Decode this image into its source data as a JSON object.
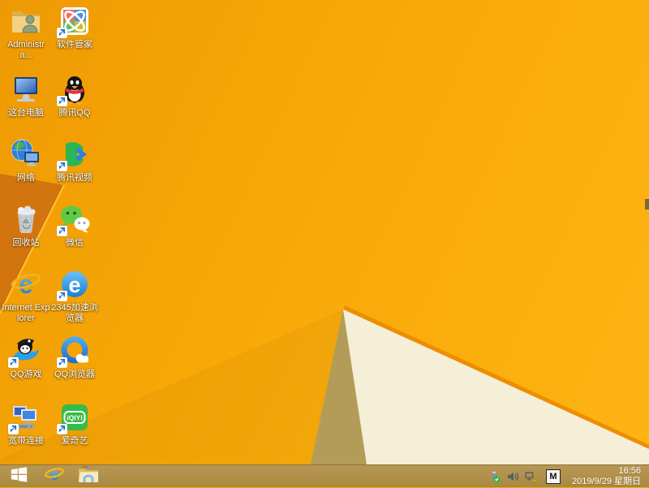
{
  "wallpaper": {
    "base_color": "#f7a807",
    "facet_cream": "#f5efd8",
    "facet_shadow_tan": "#b39c58",
    "facet_rust": "#d2750e",
    "ridge_amber": "#ee8d00",
    "ridge_light": "#ffc33a"
  },
  "desktop": {
    "icons": [
      {
        "id": "user-folder",
        "label": "Administra...",
        "col": 1,
        "row": 1,
        "shortcut": false
      },
      {
        "id": "software-manager",
        "label": "软件管家",
        "col": 2,
        "row": 1,
        "shortcut": true
      },
      {
        "id": "this-pc",
        "label": "这台电脑",
        "col": 1,
        "row": 2,
        "shortcut": false
      },
      {
        "id": "tencent-qq",
        "label": "腾讯QQ",
        "col": 2,
        "row": 2,
        "shortcut": true
      },
      {
        "id": "network",
        "label": "网络",
        "col": 1,
        "row": 3,
        "shortcut": false
      },
      {
        "id": "tencent-video",
        "label": "腾讯视频",
        "col": 2,
        "row": 3,
        "shortcut": true
      },
      {
        "id": "recycle-bin",
        "label": "回收站",
        "col": 1,
        "row": 4,
        "shortcut": false
      },
      {
        "id": "wechat",
        "label": "微信",
        "col": 2,
        "row": 4,
        "shortcut": true
      },
      {
        "id": "internet-explorer",
        "label": "Internet Explorer",
        "col": 1,
        "row": 5,
        "shortcut": false
      },
      {
        "id": "browser-2345",
        "label": "2345加速浏览器",
        "col": 2,
        "row": 5,
        "shortcut": true
      },
      {
        "id": "qq-game",
        "label": "QQ游戏",
        "col": 1,
        "row": 6,
        "shortcut": true
      },
      {
        "id": "qq-browser",
        "label": "QQ浏览器",
        "col": 2,
        "row": 6,
        "shortcut": true
      },
      {
        "id": "broadband",
        "label": "宽带连接",
        "col": 1,
        "row": 7,
        "shortcut": true
      },
      {
        "id": "iqiyi",
        "label": "爱奇艺",
        "col": 2,
        "row": 7,
        "shortcut": true
      }
    ]
  },
  "taskbar": {
    "color": "#b09049",
    "app_icons": [
      "windows-start",
      "internet-explorer",
      "file-explorer"
    ],
    "tray_icons": [
      "usb-safely-remove",
      "volume",
      "network-warning"
    ],
    "ime_label": "M",
    "clock": {
      "time": "16:56",
      "date": "2019/9/29 星期日"
    }
  }
}
